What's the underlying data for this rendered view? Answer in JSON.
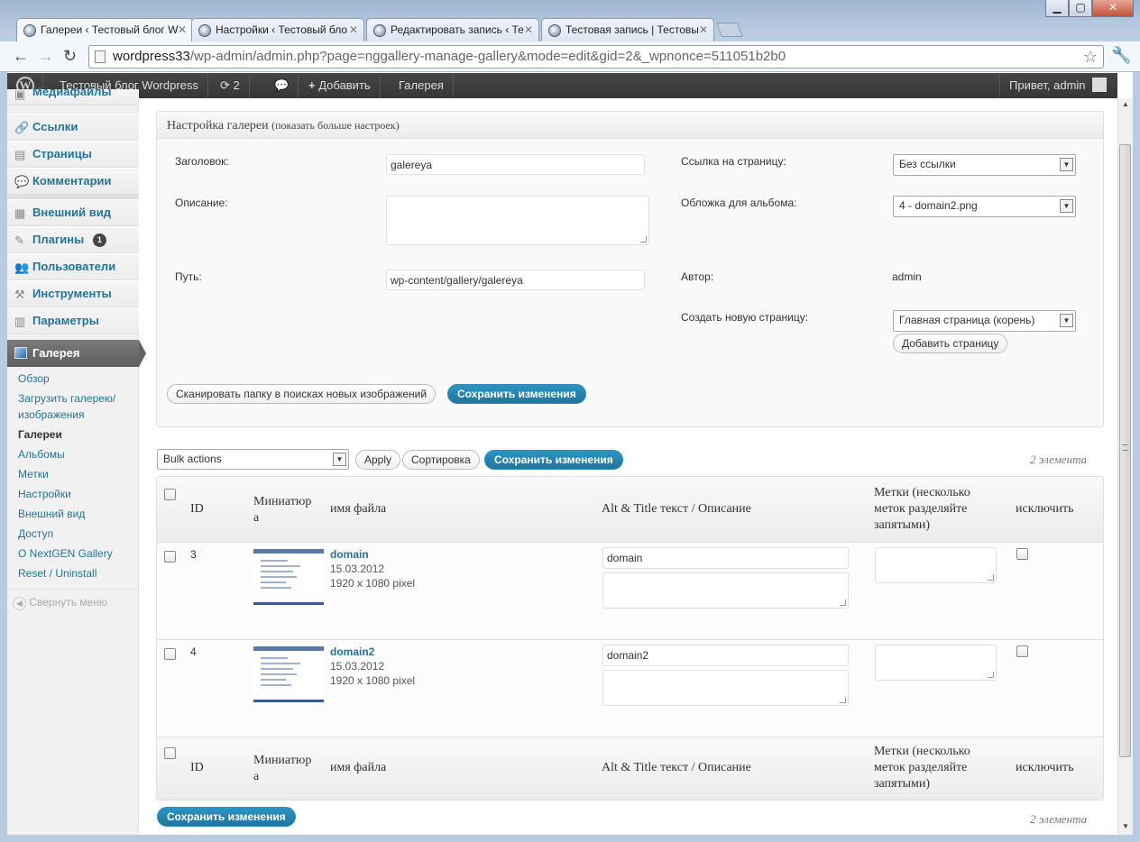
{
  "browser": {
    "tabs": [
      {
        "title": "Галереи ‹ Тестовый блог W",
        "active": true
      },
      {
        "title": "Настройки ‹ Тестовый бло",
        "active": false
      },
      {
        "title": "Редактировать запись ‹ Те",
        "active": false
      },
      {
        "title": "Тестовая запись | Тестовы",
        "active": false
      }
    ],
    "url_host": "wordpress33",
    "url_path": "/wp-admin/admin.php?page=nggallery-manage-gallery&mode=edit&gid=2&_wpnonce=511051b2b0"
  },
  "adminbar": {
    "site_name": "Тестовый блог Wordpress",
    "updates_count": "2",
    "add_label": "Добавить",
    "gallery_label": "Галерея",
    "greeting": "Привет, admin"
  },
  "sidebar": {
    "items": [
      {
        "label": "Медиафайлы",
        "icon": "media-icon"
      },
      {
        "label": "Ссылки",
        "icon": "links-icon"
      },
      {
        "label": "Страницы",
        "icon": "pages-icon"
      },
      {
        "label": "Комментарии",
        "icon": "comments-icon"
      },
      {
        "label": "Внешний вид",
        "icon": "appearance-icon"
      },
      {
        "label": "Плагины",
        "icon": "plugins-icon",
        "badge": "1"
      },
      {
        "label": "Пользователи",
        "icon": "users-icon"
      },
      {
        "label": "Инструменты",
        "icon": "tools-icon"
      },
      {
        "label": "Параметры",
        "icon": "settings-icon"
      }
    ],
    "gallery_label": "Галерея",
    "gallery_sub": [
      "Обзор",
      "Загрузить галерею/",
      "изображения",
      "Галереи",
      "Альбомы",
      "Метки",
      "Настройки",
      "Внешний вид",
      "Доступ",
      "О NextGEN Gallery",
      "Reset / Uninstall"
    ],
    "collapse_label": "Свернуть меню"
  },
  "settings": {
    "header": "Настройка галереи",
    "header_link": "(показать больше настроек)",
    "title_label": "Заголовок:",
    "title_value": "galereya",
    "description_label": "Описание:",
    "path_label": "Путь:",
    "path_value": "wp-content/gallery/galereya",
    "page_link_label": "Ссылка на страницу:",
    "page_link_value": "Без ссылки",
    "cover_label": "Обложка для альбома:",
    "cover_value": "4 - domain2.png",
    "author_label": "Автор:",
    "author_value": "admin",
    "new_page_label": "Создать новую страницу:",
    "new_page_value": "Главная страница (корень)",
    "add_page_btn": "Добавить страницу",
    "scan_btn": "Сканировать папку в поисках новых изображений",
    "save_btn": "Сохранить изменения"
  },
  "actions": {
    "bulk": "Bulk actions",
    "apply": "Apply",
    "sort": "Сортировка",
    "save": "Сохранить изменения",
    "count": "2 элемента"
  },
  "table": {
    "col_id": "ID",
    "col_thumb_1": "Миниатюр",
    "col_thumb_2": "а",
    "col_file": "имя файла",
    "col_alt": "Alt & Title текст / Описание",
    "col_tags_1": "Метки (несколько",
    "col_tags_2": "меток разделяйте",
    "col_tags_3": "запятыми)",
    "col_exclude": "исключить",
    "rows": [
      {
        "id": "3",
        "file": "domain",
        "date": "15.03.2012",
        "size": "1920 x 1080 pixel",
        "alt": "domain"
      },
      {
        "id": "4",
        "file": "domain2",
        "date": "15.03.2012",
        "size": "1920 x 1080 pixel",
        "alt": "domain2"
      }
    ]
  },
  "footer": {
    "save": "Сохранить изменения",
    "count": "2 элемента"
  }
}
